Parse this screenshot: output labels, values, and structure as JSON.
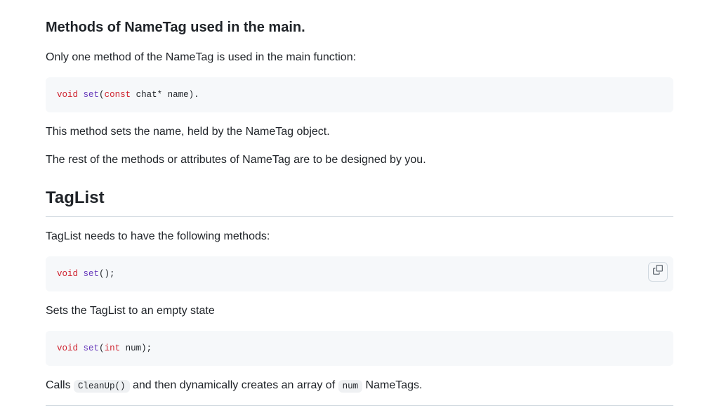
{
  "section1": {
    "heading": "Methods of NameTag used in the main.",
    "intro": "Only one method of the NameTag is used in the main function:",
    "code1": {
      "kw": "void",
      "sp": " ",
      "fn": "set",
      "args_open": "(",
      "const": "const",
      "rest": " chat* name)."
    },
    "p1": "This method sets the name, held by the NameTag object.",
    "p2": "The rest of the methods or attributes of NameTag are to be designed by you."
  },
  "section2": {
    "heading": "TagList",
    "intro": "TagList needs to have the following methods:",
    "code1": {
      "kw": "void",
      "sp": " ",
      "fn": "set",
      "rest": "();"
    },
    "p1": "Sets the TagList to an empty state",
    "code2": {
      "kw": "void",
      "sp": " ",
      "fn": "set",
      "open": "(",
      "type": "int",
      "rest": " num);"
    },
    "p2_a": "Calls ",
    "p2_code": "CleanUp()",
    "p2_b": " and then dynamically creates an array of ",
    "p2_code2": "num",
    "p2_c": " NameTags."
  },
  "icons": {
    "copy": "copy-icon"
  }
}
